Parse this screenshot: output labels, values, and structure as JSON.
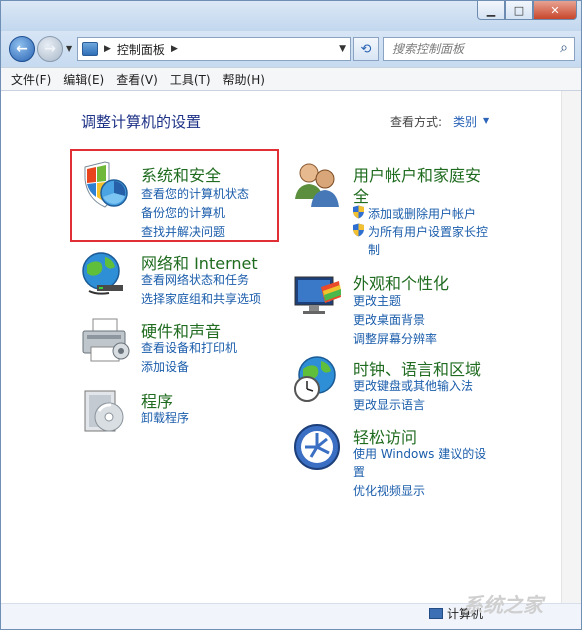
{
  "toolbar": {
    "address": "控制面板",
    "search_placeholder": "搜索控制面板"
  },
  "menu": [
    "文件(F)",
    "编辑(E)",
    "查看(V)",
    "工具(T)",
    "帮助(H)"
  ],
  "page": {
    "title": "调整计算机的设置",
    "view_by_label": "查看方式:",
    "view_by_value": "类别"
  },
  "categories_left": [
    {
      "title": "系统和安全",
      "links": [
        "查看您的计算机状态",
        "备份您的计算机",
        "查找并解决问题"
      ],
      "icon": "shield-icon"
    },
    {
      "title": "网络和 Internet",
      "links": [
        "查看网络状态和任务",
        "选择家庭组和共享选项"
      ],
      "icon": "globe-network-icon"
    },
    {
      "title": "硬件和声音",
      "links": [
        "查看设备和打印机",
        "添加设备"
      ],
      "icon": "printer-icon"
    },
    {
      "title": "程序",
      "links": [
        "卸载程序"
      ],
      "icon": "programs-icon"
    }
  ],
  "categories_right": [
    {
      "title_line1": "用户帐户和家庭安",
      "title_line2": "全",
      "links": [
        "添加或删除用户帐户",
        "为所有用户设置家长控",
        "制"
      ],
      "icon": "users-icon"
    },
    {
      "title": "外观和个性化",
      "links": [
        "更改主题",
        "更改桌面背景",
        "调整屏幕分辨率"
      ],
      "icon": "display-icon"
    },
    {
      "title": "时钟、语言和区域",
      "links": [
        "更改键盘或其他输入法",
        "更改显示语言"
      ],
      "icon": "globe-clock-icon"
    },
    {
      "title": "轻松访问",
      "links": [
        "使用 Windows 建议的设",
        "置",
        "优化视频显示"
      ],
      "icon": "accessibility-icon"
    }
  ],
  "status": {
    "text": "计算机"
  },
  "watermark": "系统之家",
  "colors": {
    "title_green": "#1f6b1f",
    "link_blue": "#1b5dab",
    "highlight_red": "#e03035"
  }
}
